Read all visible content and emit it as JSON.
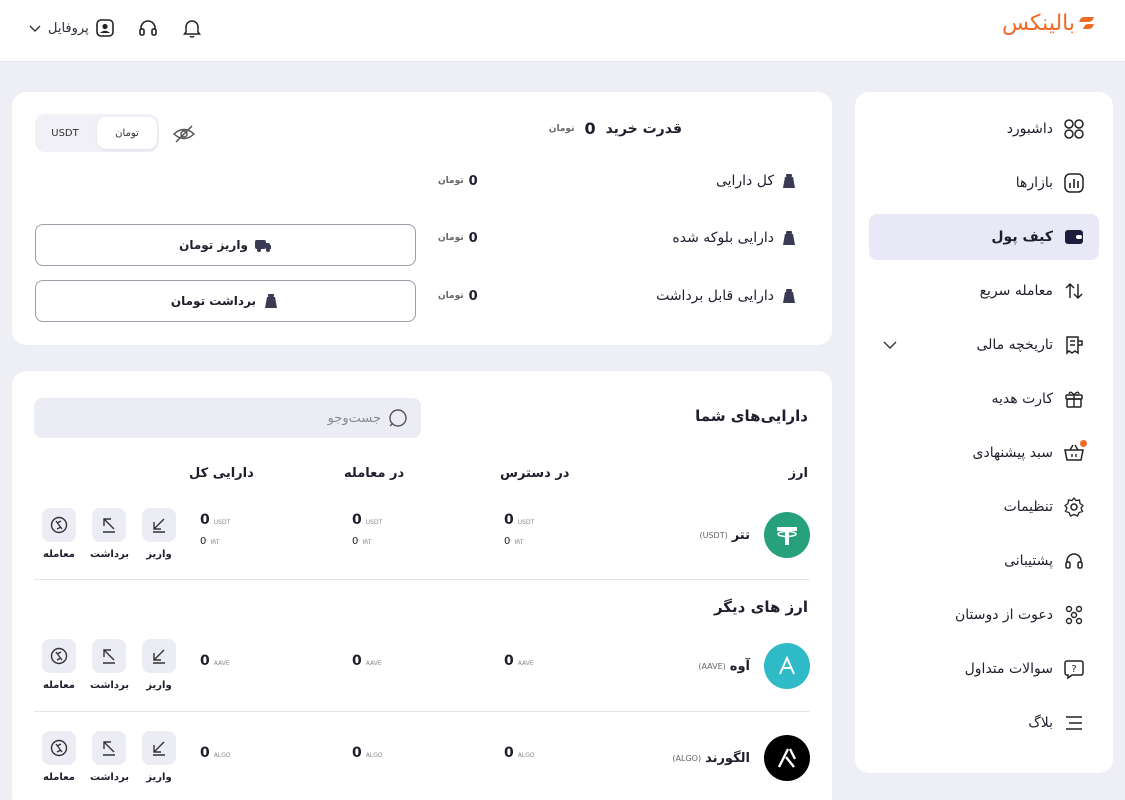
{
  "brand": {
    "name": "بالینکس",
    "color": "#f06a2a"
  },
  "topbar": {
    "profile_label": "پروفایل",
    "icons": [
      "user-icon",
      "headset-icon",
      "bell-icon",
      "chevron-down-icon"
    ]
  },
  "sidebar": {
    "items": [
      {
        "label": "داشبورد",
        "icon": "dashboard-icon"
      },
      {
        "label": "بازارها",
        "icon": "markets-icon"
      },
      {
        "label": "کیف پول",
        "icon": "wallet-icon",
        "active": true
      },
      {
        "label": "معامله سریع",
        "icon": "swap-icon"
      },
      {
        "label": "تاریخچه مالی",
        "icon": "receipt-icon",
        "expandable": true
      },
      {
        "label": "کارت هدیه",
        "icon": "gift-icon"
      },
      {
        "label": "سبد پیشنهادی",
        "icon": "basket-icon",
        "badge": true
      },
      {
        "label": "تنظیمات",
        "icon": "gear-icon"
      },
      {
        "label": "پشتیبانی",
        "icon": "headset-icon"
      },
      {
        "label": "دعوت از دوستان",
        "icon": "invite-icon"
      },
      {
        "label": "سوالات متداول",
        "icon": "faq-icon"
      },
      {
        "label": "بلاگ",
        "icon": "blog-icon"
      }
    ]
  },
  "summary": {
    "currency_toggle": {
      "options": [
        "تومان",
        "USDT"
      ],
      "selected": "تومان"
    },
    "purchase_power": {
      "label": "قدرت خرید",
      "value": "0",
      "unit": "تومان"
    },
    "rows": [
      {
        "label": "کل دارایی",
        "value": "0",
        "unit": "تومان"
      },
      {
        "label": "دارایی بلوکه شده",
        "value": "0",
        "unit": "تومان"
      },
      {
        "label": "دارایی قابل برداشت",
        "value": "0",
        "unit": "تومان"
      }
    ],
    "deposit_button": "واریز تومان",
    "withdraw_button": "برداشت تومان"
  },
  "assets": {
    "title": "دارایی‌های شما",
    "search_placeholder": "جست‌وجو",
    "columns": {
      "currency": "ارز",
      "available": "در دسترس",
      "in_trade": "در معامله",
      "total": "دارایی کل"
    },
    "actions": {
      "deposit": "واریز",
      "withdraw": "برداشت",
      "trade": "معامله"
    },
    "main_rows": [
      {
        "name": "تتر",
        "code": "(USDT)",
        "unit": "USDT",
        "color": "#26a17b",
        "glyph": "T",
        "available": "0",
        "available_irt": "0",
        "in_trade": "0",
        "in_trade_irt": "0",
        "total": "0",
        "total_irt": "0",
        "irt_unit": "IRT"
      }
    ],
    "other_title": "ارز های دیگر",
    "other_rows": [
      {
        "name": "آوه",
        "code": "(AAVE)",
        "unit": "AAVE",
        "color": "#2ebac6",
        "glyph": "Λ",
        "available": "0",
        "in_trade": "0",
        "total": "0"
      },
      {
        "name": "الگورند",
        "code": "(ALGO)",
        "unit": "ALGO",
        "color": "#000000",
        "glyph": "A",
        "available": "0",
        "in_trade": "0",
        "total": "0"
      }
    ]
  }
}
